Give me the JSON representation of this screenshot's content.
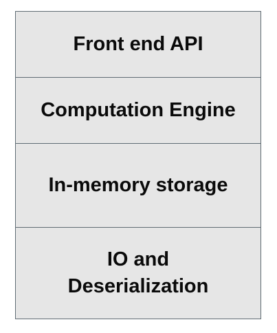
{
  "diagram": {
    "layers": [
      {
        "label": "Front end API"
      },
      {
        "label": "Computation Engine"
      },
      {
        "label": "In-memory storage"
      },
      {
        "label": "IO and Deserialization"
      }
    ]
  }
}
